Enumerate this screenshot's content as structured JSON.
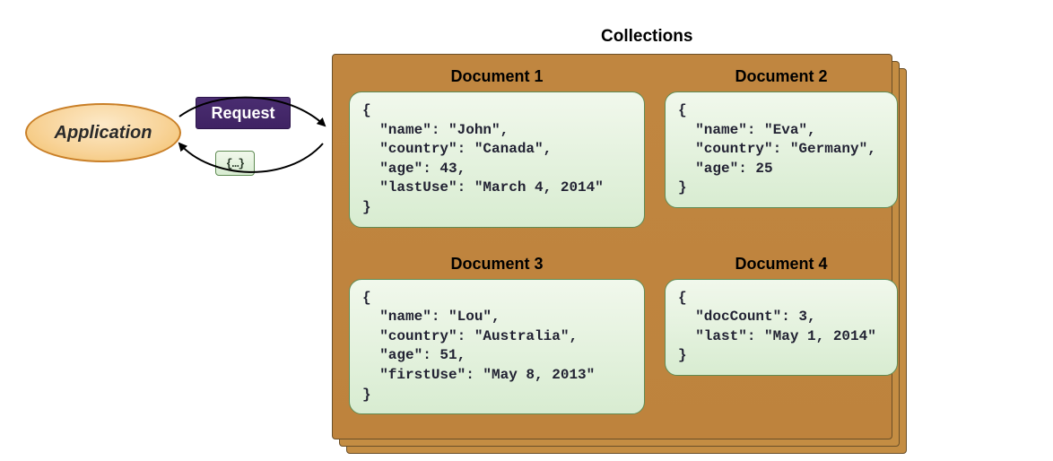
{
  "diagram": {
    "collectionsTitle": "Collections",
    "applicationLabel": "Application",
    "requestLabel": "Request",
    "responseChip": "{…}",
    "documents": [
      {
        "title": "Document 1",
        "json": "{\n  \"name\": \"John\",\n  \"country\": \"Canada\",\n  \"age\": 43,\n  \"lastUse\": \"March 4, 2014\"\n}"
      },
      {
        "title": "Document 2",
        "json": "{\n  \"name\": \"Eva\",\n  \"country\": \"Germany\",\n  \"age\": 25\n}"
      },
      {
        "title": "Document 3",
        "json": "{\n  \"name\": \"Lou\",\n  \"country\": \"Australia\",\n  \"age\": 51,\n  \"firstUse\": \"May 8, 2013\"\n}"
      },
      {
        "title": "Document 4",
        "json": "{\n  \"docCount\": 3,\n  \"last\": \"May 1, 2014\"\n}"
      }
    ]
  }
}
